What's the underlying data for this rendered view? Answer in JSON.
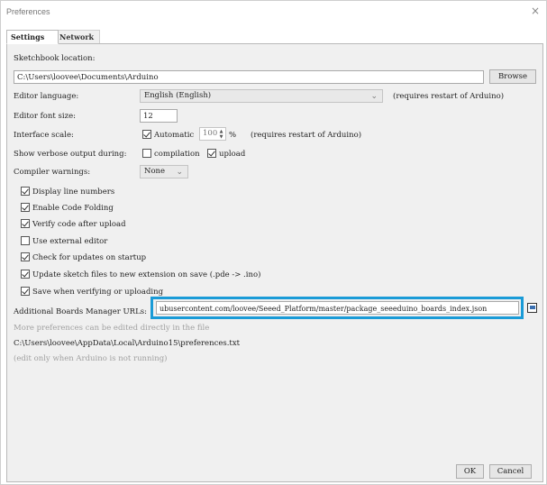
{
  "window": {
    "title": "Preferences",
    "close_glyph": "×"
  },
  "tabs": [
    {
      "label": "Settings"
    },
    {
      "label": "Network"
    }
  ],
  "sketchbook": {
    "label": "Sketchbook location:",
    "path": "C:\\Users\\loovee\\Documents\\Arduino",
    "browse_label": "Browse"
  },
  "editor_language": {
    "label": "Editor language:",
    "value": "English (English)",
    "note": "(requires restart of Arduino)"
  },
  "editor_font_size": {
    "label": "Editor font size:",
    "value": "12"
  },
  "interface_scale": {
    "label": "Interface scale:",
    "automatic_label": "Automatic",
    "automatic_checked": true,
    "value": "100",
    "unit": "%",
    "note": "(requires restart of Arduino)"
  },
  "verbose": {
    "label": "Show verbose output during:",
    "compilation_label": "compilation",
    "compilation_checked": false,
    "upload_label": "upload",
    "upload_checked": true
  },
  "compiler_warnings": {
    "label": "Compiler warnings:",
    "value": "None"
  },
  "options": [
    {
      "label": "Display line numbers",
      "checked": true
    },
    {
      "label": "Enable Code Folding",
      "checked": true
    },
    {
      "label": "Verify code after upload",
      "checked": true
    },
    {
      "label": "Use external editor",
      "checked": false
    },
    {
      "label": "Check for updates on startup",
      "checked": true
    },
    {
      "label": "Update sketch files to new extension on save (.pde -> .ino)",
      "checked": true
    },
    {
      "label": "Save when verifying or uploading",
      "checked": true
    }
  ],
  "boards_manager": {
    "label": "Additional Boards Manager URLs:",
    "value": "ubusercontent.com/loovee/Seeed_Platform/master/package_seeeduino_boards_index.json"
  },
  "info": {
    "more_prefs": "More preferences can be edited directly in the file",
    "prefs_path": "C:\\Users\\loovee\\AppData\\Local\\Arduino15\\preferences.txt",
    "edit_note": "(edit only when Arduino is not running)"
  },
  "footer": {
    "ok_label": "OK",
    "cancel_label": "Cancel"
  },
  "colors": {
    "highlight": "#1a9bd7",
    "panel": "#f0f0f0"
  }
}
